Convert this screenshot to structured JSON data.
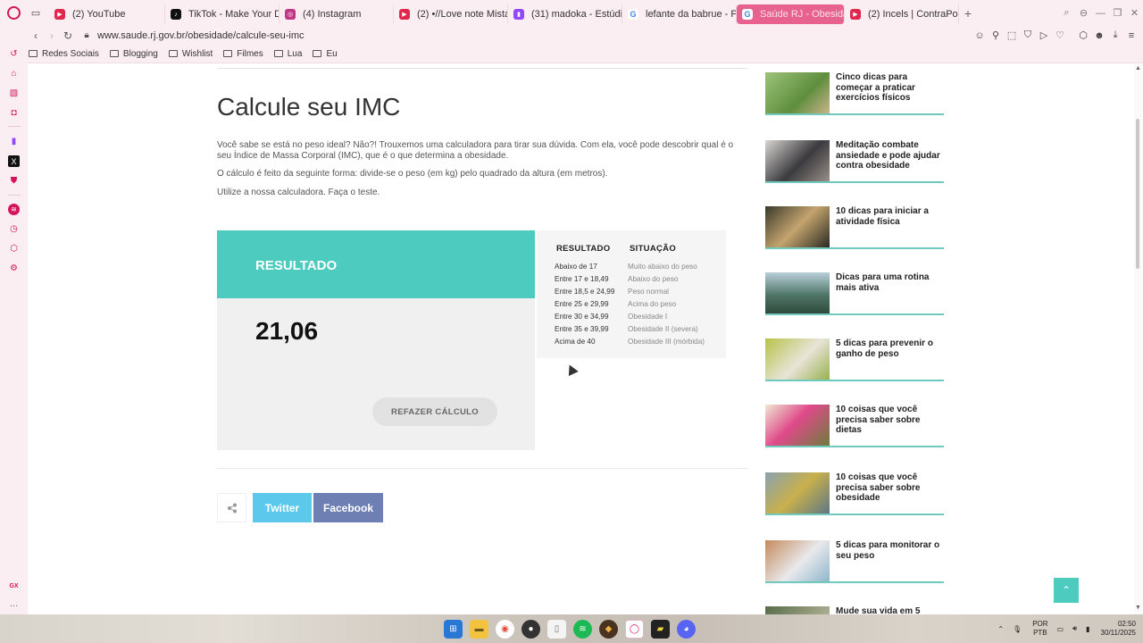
{
  "browser": {
    "tabs": [
      {
        "label": "(2) YouTube",
        "icon": "youtube-icon",
        "color": "#e0264a"
      },
      {
        "label": "TikTok - Make Your Day",
        "icon": "tiktok-icon",
        "color": "#111111"
      },
      {
        "label": "(4) Instagram",
        "icon": "instagram-icon",
        "color": "#c13584"
      },
      {
        "label": "(2) •//Love note Mistake/",
        "icon": "youtube-icon",
        "color": "#e0264a"
      },
      {
        "label": "(31) madoka - Estúdio de",
        "icon": "twitch-icon",
        "color": "#9146ff"
      },
      {
        "label": "lefante da babrue - Pesq",
        "icon": "google-icon",
        "color": "#4285f4"
      },
      {
        "label": "Saúde RJ - Obesidade -",
        "icon": "google-icon",
        "color": "#4285f4"
      },
      {
        "label": "(2) Incels | ContraPoints",
        "icon": "youtube-icon",
        "color": "#e0264a"
      }
    ],
    "url": "www.saude.rj.gov.br/obesidade/calcule-seu-imc",
    "bookmarks": [
      "Redes Sociais",
      "Blogging",
      "Wishlist",
      "Filmes",
      "Lua",
      "Eu"
    ]
  },
  "page": {
    "title": "Calcule seu IMC",
    "paragraphs": [
      "Você sabe se está no peso ideal? Não?! Trouxemos uma calculadora para tirar sua dúvida. Com ela, você pode descobrir qual é o seu Índice de Massa Corporal (IMC), que é o que determina a obesidade.",
      "O cálculo é feito da seguinte forma: divide-se o peso (em kg) pelo quadrado da altura (em metros).",
      "Utilize a nossa calculadora. Faça o teste."
    ],
    "result": {
      "label": "RESULTADO",
      "value": "21,06",
      "redo_button": "REFAZER CÁLCULO"
    },
    "table": {
      "headers": [
        "RESULTADO",
        "SITUAÇÃO"
      ],
      "rows": [
        [
          "Abaixo de 17",
          "Muito abaixo do peso"
        ],
        [
          "Entre 17 e 18,49",
          "Abaixo do peso"
        ],
        [
          "Entre 18,5 e 24,99",
          "Peso normal"
        ],
        [
          "Entre 25 e 29,99",
          "Acima do peso"
        ],
        [
          "Entre 30 e 34,99",
          "Obesidade I"
        ],
        [
          "Entre 35 e 39,99",
          "Obesidade II (severa)"
        ],
        [
          "Acima de 40",
          "Obesidade III (mórbida)"
        ]
      ]
    },
    "share": {
      "twitter": "Twitter",
      "facebook": "Facebook",
      "twitter_color": "#5bc8ec",
      "facebook_color": "#6d7fb3"
    },
    "accent_color": "#4ecbbf"
  },
  "related": [
    "Cinco dicas para começar a praticar exercícios físicos",
    "Meditação combate ansiedade e pode ajudar contra obesidade",
    "10 dicas para iniciar a atividade física",
    "Dicas para uma rotina mais ativa",
    "5 dicas para prevenir o ganho de peso",
    "10 coisas que você precisa saber sobre dietas",
    "10 coisas que você precisa saber sobre obesidade",
    "5 dicas para monitorar o seu peso",
    "Mude sua vida em 5"
  ],
  "taskbar": {
    "lang1": "POR",
    "lang2": "PTB",
    "time": "02:50",
    "date": "30/11/2025"
  }
}
